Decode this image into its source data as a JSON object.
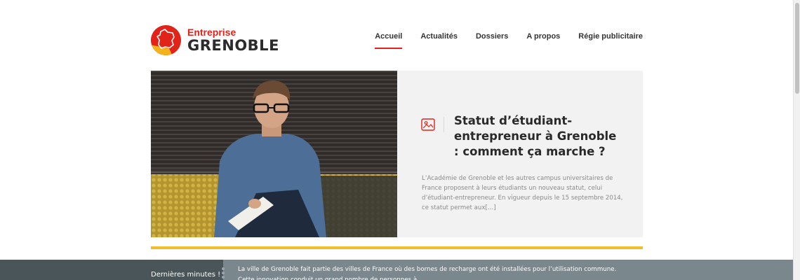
{
  "logo": {
    "top": "Entreprise",
    "bottom": "GRENOBLE",
    "icon": "france-map-icon"
  },
  "nav": {
    "items": [
      {
        "label": "Accueil",
        "active": true
      },
      {
        "label": "Actualités",
        "active": false
      },
      {
        "label": "Dossiers",
        "active": false
      },
      {
        "label": "A propos",
        "active": false
      },
      {
        "label": "Régie publicitaire",
        "active": false
      }
    ]
  },
  "feature": {
    "icon": "image-format-icon",
    "title": "Statut d’étudiant-entrepreneur à Grenoble : comment ça marche ?",
    "excerpt": "L’Académie de Grenoble et les autres campus universitaires de France proposent à leurs étudiants un nouveau statut, celui d’étudiant-entrepreneur. En vigueur depuis le 15 septembre 2014, ce statut permet aux[…]"
  },
  "ticker": {
    "label": "Dernières minutes !",
    "text": "La ville de Grenoble fait partie des villes de France où des bornes de recharge ont été installées pour l’utilisation commune. Cette innovation conduit un grand nombre de personnes à..."
  },
  "colors": {
    "brand_red": "#e2231a",
    "accent_yellow": "#f2bd2b",
    "ticker_bg": "#7a878d",
    "ticker_label_bg": "#4a5559"
  }
}
